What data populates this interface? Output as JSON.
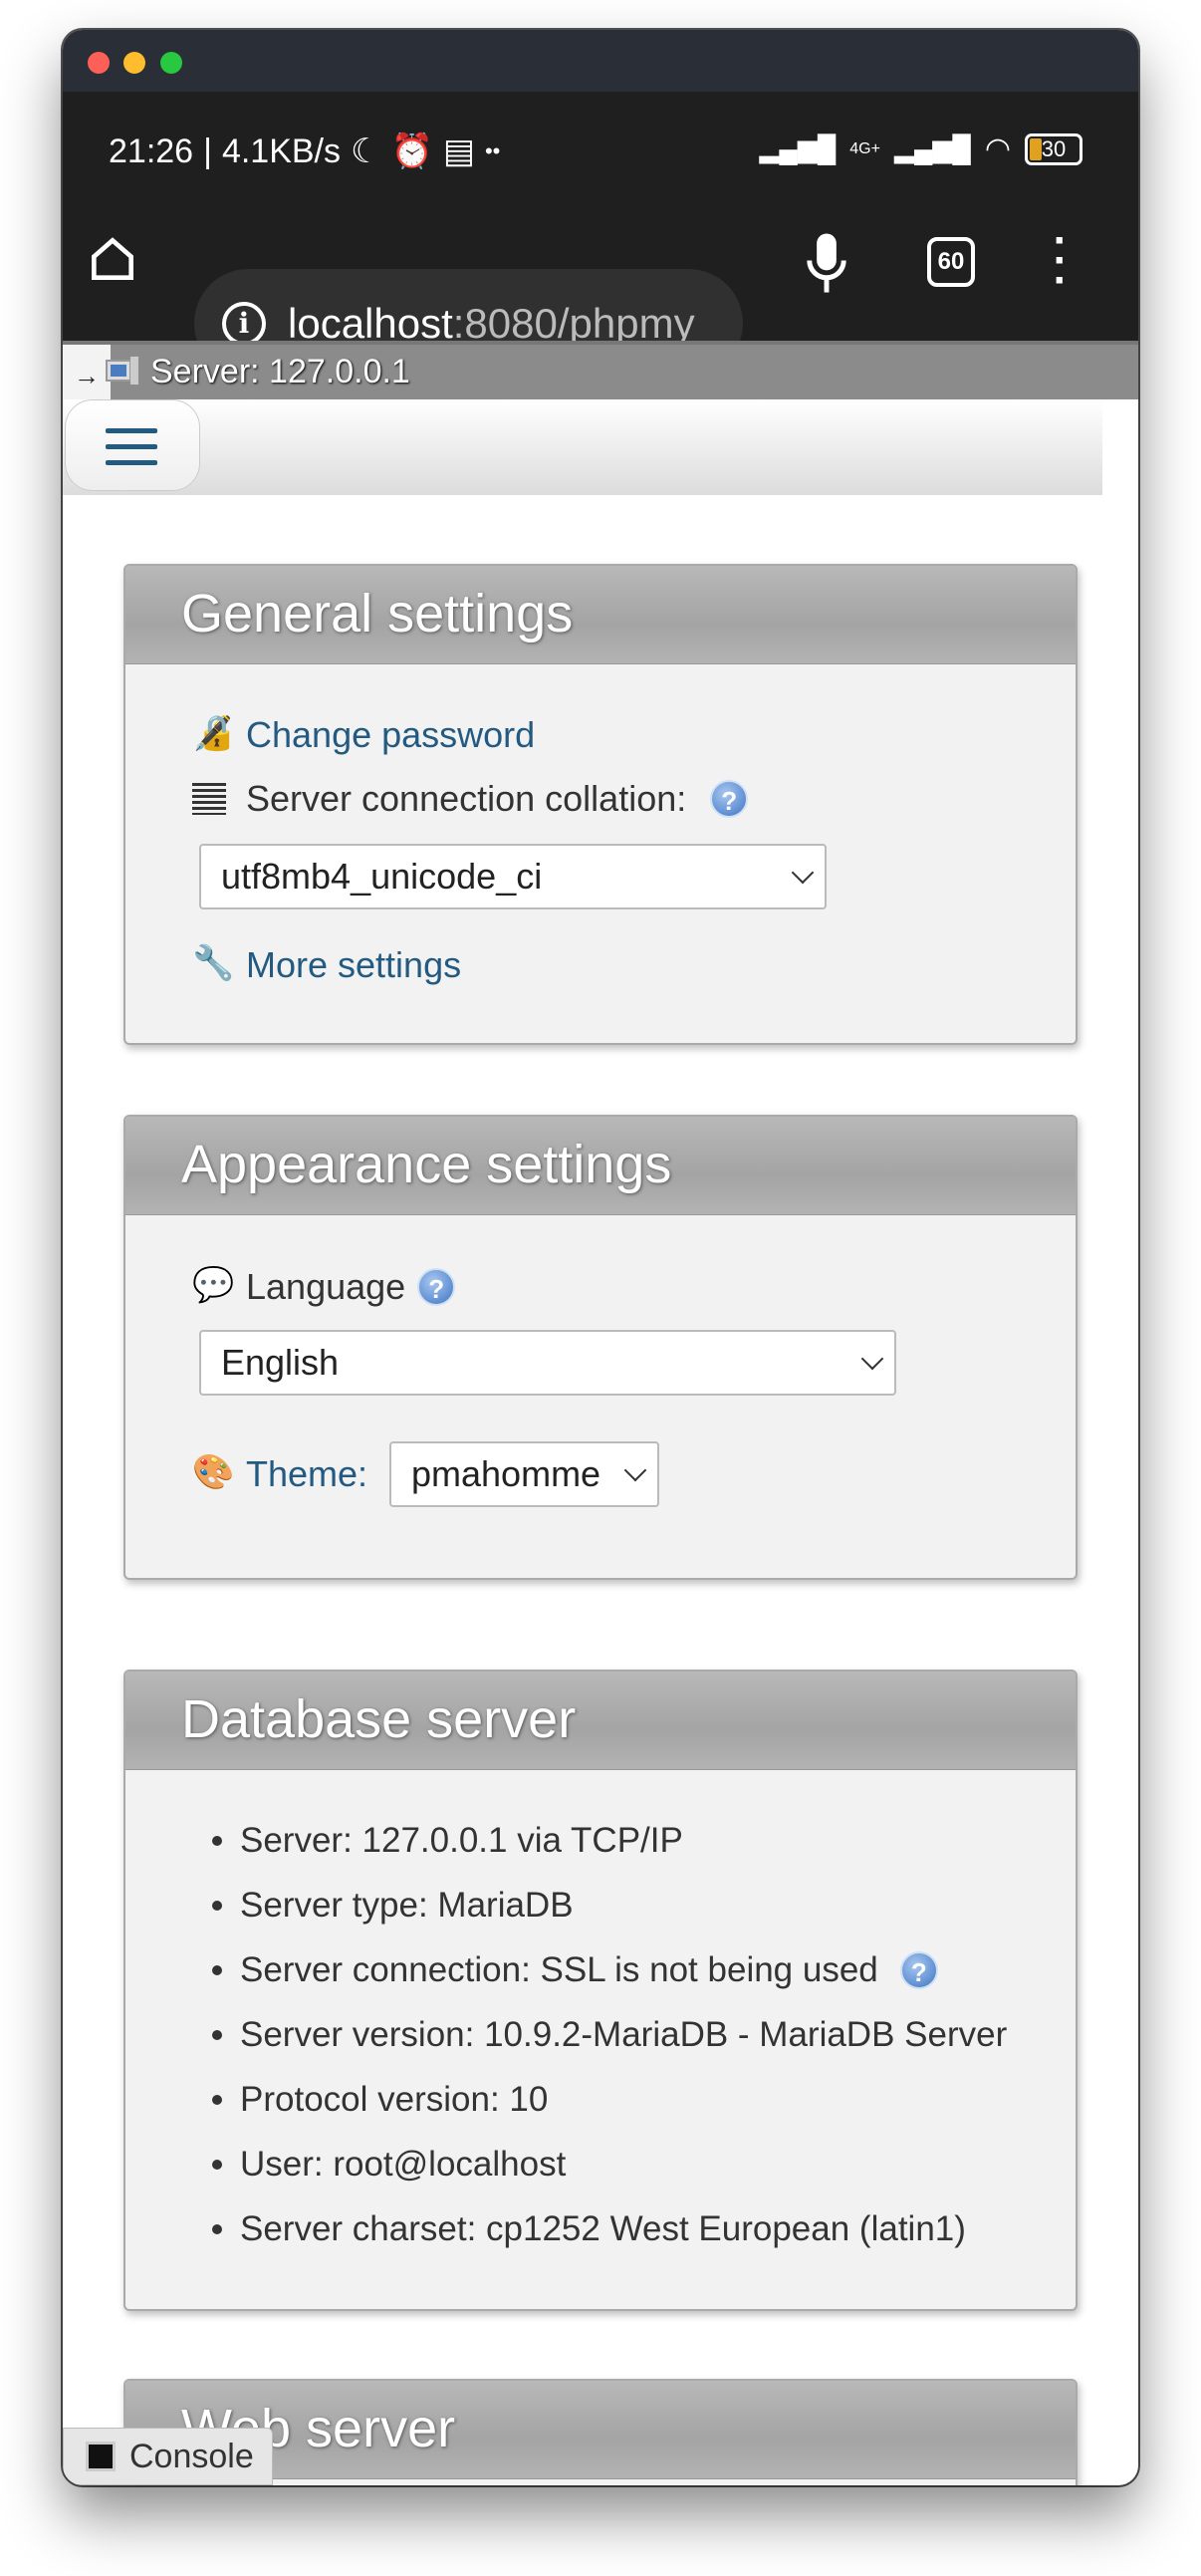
{
  "status_bar": {
    "time": "21:26",
    "speed": "4.1KB/s",
    "network": "4G+",
    "battery": "30",
    "icons": [
      "moon-icon",
      "alarm-icon",
      "calendar-icon",
      "more-dots-icon",
      "signal-icon",
      "signal-4g-icon",
      "wifi-icon",
      "battery-icon"
    ]
  },
  "browser": {
    "url_host": "localhost",
    "url_path": ":8080/phpmy",
    "tab_count": "60",
    "icons": [
      "home-icon",
      "info-icon",
      "mic-icon",
      "tabs-icon",
      "menu-icon"
    ]
  },
  "server_bar": {
    "arrow": "→",
    "label": "Server: 127.0.0.1"
  },
  "general": {
    "title": "General settings",
    "change_password": "Change password",
    "collation_label": "Server connection collation:",
    "collation_value": "utf8mb4_unicode_ci",
    "more_settings": "More settings"
  },
  "appearance": {
    "title": "Appearance settings",
    "language_label": "Language",
    "language_value": "English",
    "theme_label": "Theme:",
    "theme_value": "pmahomme"
  },
  "database": {
    "title": "Database server",
    "items": [
      "Server: 127.0.0.1 via TCP/IP",
      "Server type: MariaDB",
      "Server connection: SSL is not being used",
      "Server version: 10.9.2-MariaDB - MariaDB Server",
      "Protocol version: 10",
      "User: root@localhost",
      "Server charset: cp1252 West European (latin1)"
    ]
  },
  "web": {
    "title": "Web server"
  },
  "console": {
    "label": "Console"
  },
  "help_glyph": "?",
  "colors": {
    "link": "#235a81",
    "header": "#a9a9a9",
    "box_bg": "#f2f2f2"
  }
}
